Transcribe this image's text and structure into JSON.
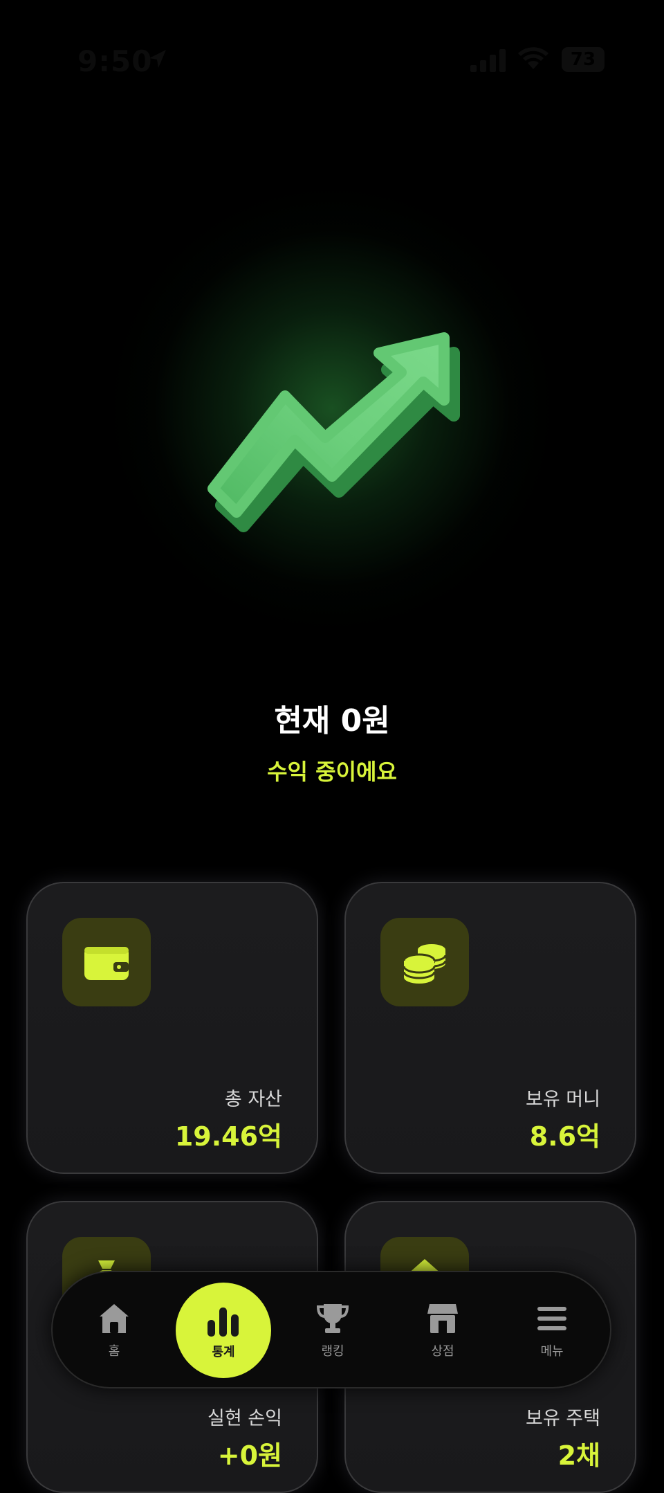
{
  "status_bar": {
    "time": "9:50",
    "battery": "73",
    "icons": [
      "location-arrow-icon",
      "signal-icon",
      "wifi-icon",
      "battery-icon"
    ]
  },
  "hero": {
    "icon": "trend-up-arrow-icon",
    "title": "현재 0원",
    "subtitle": "수익 중이에요"
  },
  "cards": [
    {
      "icon": "wallet-icon",
      "label": "총 자산",
      "value": "19.46억"
    },
    {
      "icon": "coins-icon",
      "label": "보유 머니",
      "value": "8.6억"
    },
    {
      "icon": "money-bag-icon",
      "label": "실현 손익",
      "value": "+0원"
    },
    {
      "icon": "house-icon",
      "label": "보유 주택",
      "value": "2채"
    }
  ],
  "tab_bar": {
    "items": [
      {
        "label": "홈",
        "icon": "home-icon"
      },
      {
        "label": "통계",
        "icon": "bar-chart-icon",
        "active": true
      },
      {
        "label": "랭킹",
        "icon": "trophy-icon"
      },
      {
        "label": "상점",
        "icon": "store-icon"
      },
      {
        "label": "메뉴",
        "icon": "menu-icon"
      }
    ]
  },
  "colors": {
    "background": "#000000",
    "accent": "#d8f43a",
    "card_bg": "#1c1c1e",
    "icon_box": "#3a3d12",
    "arrow_green": "#5ec46f"
  }
}
